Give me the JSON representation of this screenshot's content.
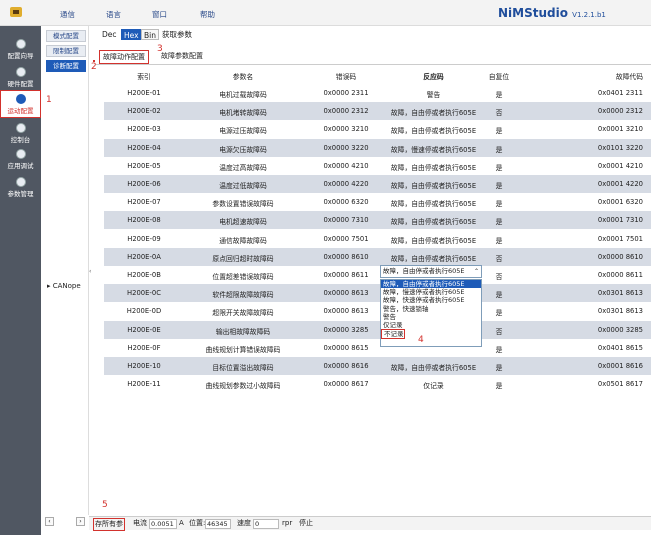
{
  "menu": [
    "通信",
    "语言",
    "窗口",
    "帮助"
  ],
  "brand": {
    "name": "NiMStudio",
    "version": "V1.2.1.b1"
  },
  "sidebar": [
    {
      "label": "配置向导",
      "icon": "wizard-icon"
    },
    {
      "label": "硬件配置",
      "icon": "hardware-icon"
    },
    {
      "label": "运动配置",
      "icon": "motion-icon"
    },
    {
      "label": "控制台",
      "icon": "console-icon"
    },
    {
      "label": "应用调试",
      "icon": "debug-icon"
    },
    {
      "label": "参数管理",
      "icon": "params-icon"
    }
  ],
  "tree": {
    "buttons": [
      "模式配置",
      "限制配置",
      "诊断配置"
    ],
    "node": "▸ CANope"
  },
  "toolbar": {
    "dec": "Dec",
    "hex": "Hex",
    "bin": "Bin",
    "fetch": "获取参数"
  },
  "tabs": [
    "故障动作配置",
    "故障参数配置"
  ],
  "table": {
    "headers": [
      "索引",
      "参数名",
      "错误码",
      "反应码",
      "自复位",
      "故障代码"
    ],
    "rows": [
      [
        "H200E-01",
        "电机过载故障码",
        "0x0000 2311",
        "警告",
        "是",
        "0x0401 2311"
      ],
      [
        "H200E-02",
        "电机堵转故障码",
        "0x0000 2312",
        "故障，自由停或者执行605E",
        "否",
        "0x0000 2312"
      ],
      [
        "H200E-03",
        "电源过压故障码",
        "0x0000 3210",
        "故障，自由停或者执行605E",
        "是",
        "0x0001 3210"
      ],
      [
        "H200E-04",
        "电源欠压故障码",
        "0x0000 3220",
        "故障，慢速停或者执行605E",
        "是",
        "0x0101 3220"
      ],
      [
        "H200E-05",
        "温度过高故障码",
        "0x0000 4210",
        "故障，自由停或者执行605E",
        "是",
        "0x0001 4210"
      ],
      [
        "H200E-06",
        "温度过低故障码",
        "0x0000 4220",
        "故障，自由停或者执行605E",
        "是",
        "0x0001 4220"
      ],
      [
        "H200E-07",
        "参数设置错误故障码",
        "0x0000 6320",
        "故障，自由停或者执行605E",
        "是",
        "0x0001 6320"
      ],
      [
        "H200E-08",
        "电机超速故障码",
        "0x0000 7310",
        "故障，自由停或者执行605E",
        "是",
        "0x0001 7310"
      ],
      [
        "H200E-09",
        "通信故障故障码",
        "0x0000 7501",
        "故障，自由停或者执行605E",
        "是",
        "0x0001 7501"
      ],
      [
        "H200E-0A",
        "原点回归超时故障码",
        "0x0000 8610",
        "故障，自由停或者执行605E",
        "否",
        "0x0000 8610"
      ],
      [
        "H200E-0B",
        "位置超差错误故障码",
        "0x0000 8611",
        "",
        "否",
        "0x0000 8611"
      ],
      [
        "H200E-0C",
        "软件超限故障故障码",
        "0x0000 8613",
        "",
        "是",
        "0x0301 8613"
      ],
      [
        "H200E-0D",
        "超限开关故障故障码",
        "0x0000 8613",
        "",
        "是",
        "0x0301 8613"
      ],
      [
        "H200E-0E",
        "输出相故障故障码",
        "0x0000 3285",
        "",
        "否",
        "0x0000 3285"
      ],
      [
        "H200E-0F",
        "曲线规划计算错误故障码",
        "0x0000 8615",
        "",
        "是",
        "0x0401 8615"
      ],
      [
        "H200E-10",
        "目标位置溢出故障码",
        "0x0000 8616",
        "故障，自由停或者执行605E",
        "是",
        "0x0001 8616"
      ],
      [
        "H200E-11",
        "曲线规划参数过小故障码",
        "0x0000 8617",
        "仅记录",
        "是",
        "0x0501 8617"
      ]
    ]
  },
  "dropdown": {
    "selected": "故障，自由停或者执行605E",
    "options": [
      "故障，自由停或者执行605E",
      "故障，慢速停或者执行605E",
      "故障，快速停或者执行605E",
      "警告，快速锁轴",
      "警告",
      "仅记录",
      "不记录"
    ]
  },
  "annotations": [
    "1",
    "2",
    "3",
    "4",
    "5"
  ],
  "status": {
    "save_all": "存所有参",
    "current_label": "电流",
    "current_value": "0.0051",
    "current_unit": "A",
    "position_label": "位置:",
    "position_value": "46345",
    "speed_label": "速度",
    "speed_value": "0",
    "speed_unit": "rpr",
    "state": "停止"
  },
  "colors": {
    "accent": "#1e5bb8",
    "annotation": "#d2322d",
    "sidebar": "#505762",
    "row_alt": "#d6dbe4"
  }
}
